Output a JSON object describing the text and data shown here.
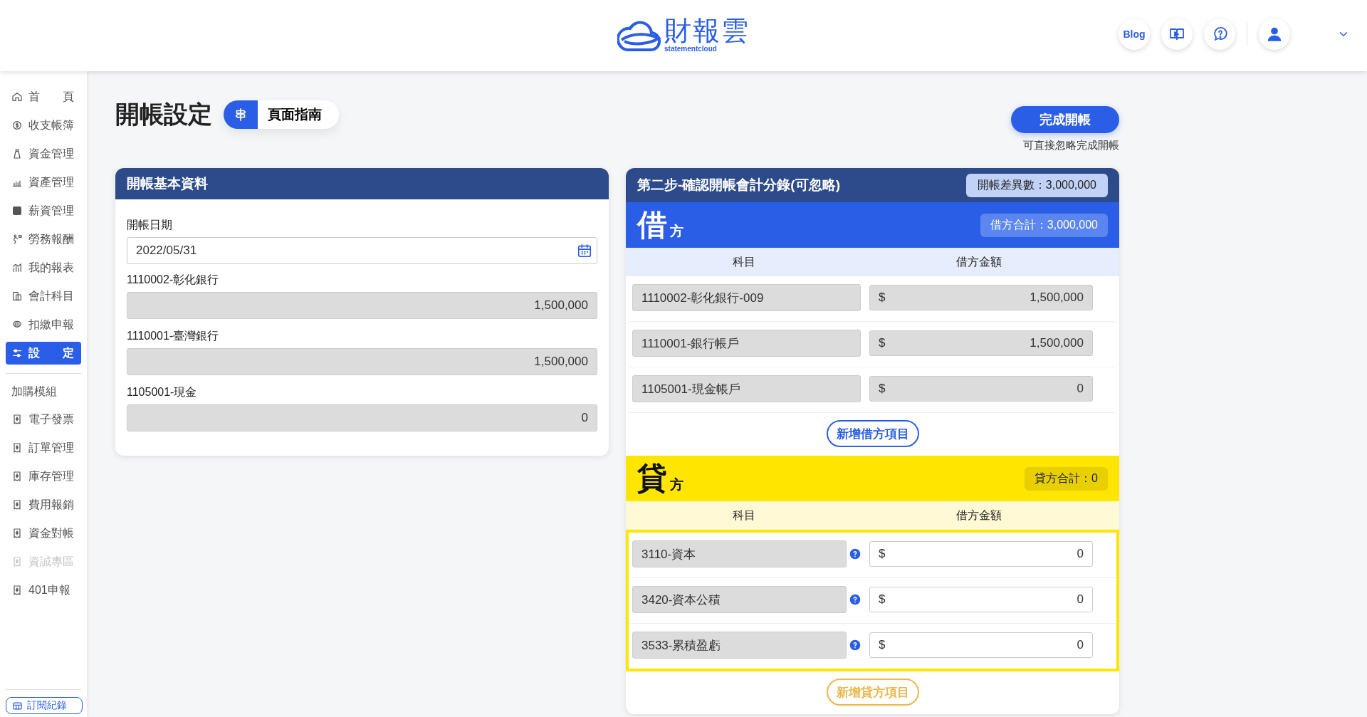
{
  "header": {
    "logo_text": "財報雲",
    "logo_subtext": "statementcloud",
    "blog_button": "Blog"
  },
  "sidebar": {
    "items": [
      {
        "label": "首　　頁",
        "selected": false,
        "disabled": false
      },
      {
        "label": "收支帳簿",
        "selected": false,
        "disabled": false
      },
      {
        "label": "資金管理",
        "selected": false,
        "disabled": false
      },
      {
        "label": "資產管理",
        "selected": false,
        "disabled": false
      },
      {
        "label": "薪資管理",
        "selected": false,
        "disabled": false
      },
      {
        "label": "勞務報酬",
        "selected": false,
        "disabled": false
      },
      {
        "label": "我的報表",
        "selected": false,
        "disabled": false
      },
      {
        "label": "會計科目",
        "selected": false,
        "disabled": false
      },
      {
        "label": "扣繳申報",
        "selected": false,
        "disabled": false
      },
      {
        "label": "設　　定",
        "selected": true,
        "disabled": false
      }
    ],
    "section_label": "加購模組",
    "modules": [
      {
        "label": "電子發票",
        "disabled": false
      },
      {
        "label": "訂單管理",
        "disabled": false
      },
      {
        "label": "庫存管理",
        "disabled": false
      },
      {
        "label": "費用報銷",
        "disabled": false
      },
      {
        "label": "資金對帳",
        "disabled": false
      },
      {
        "label": "資誠專區",
        "disabled": true
      },
      {
        "label": "401申報",
        "disabled": false
      }
    ],
    "bottom_button": "訂閱紀錄"
  },
  "page": {
    "title": "開帳設定",
    "guide_button": "頁面指南",
    "finish_button": "完成開帳",
    "finish_hint": "可直接忽略完成開帳"
  },
  "basic_card": {
    "title": "開帳基本資料",
    "date_label": "開帳日期",
    "date_value": "2022/05/31",
    "fields": [
      {
        "label": "1110002-彰化銀行",
        "value": "1,500,000"
      },
      {
        "label": "1110001-臺灣銀行",
        "value": "1,500,000"
      },
      {
        "label": "1105001-現金",
        "value": "0"
      }
    ]
  },
  "entries_card": {
    "title": "第二步-確認開帳會計分錄(可忽略)",
    "difference": "開帳差異數：3,000,000",
    "sections": [
      {
        "kind": "debit",
        "big_char": "借",
        "small_char": "方",
        "total": "借方合計：3,000,000",
        "columns": [
          "科目",
          "借方金額"
        ],
        "highlighted": false,
        "rows": [
          {
            "account": "1110002-彰化銀行-009",
            "currency": "$",
            "amount": "1,500,000",
            "readonly": true,
            "has_help": false
          },
          {
            "account": "1110001-銀行帳戶",
            "currency": "$",
            "amount": "1,500,000",
            "readonly": true,
            "has_help": false
          },
          {
            "account": "1105001-現金帳戶",
            "currency": "$",
            "amount": "0",
            "readonly": true,
            "has_help": false
          }
        ],
        "add_button": "新增借方項目"
      },
      {
        "kind": "credit",
        "big_char": "貸",
        "small_char": "方",
        "total": "貸方合計：0",
        "columns": [
          "科目",
          "借方金額"
        ],
        "highlighted": true,
        "rows": [
          {
            "account": "3110-資本",
            "currency": "$",
            "amount": "0",
            "readonly": false,
            "has_help": true
          },
          {
            "account": "3420-資本公積",
            "currency": "$",
            "amount": "0",
            "readonly": false,
            "has_help": true
          },
          {
            "account": "3533-累積盈虧",
            "currency": "$",
            "amount": "0",
            "readonly": false,
            "has_help": true
          }
        ],
        "add_button": "新增貸方項目"
      }
    ]
  }
}
